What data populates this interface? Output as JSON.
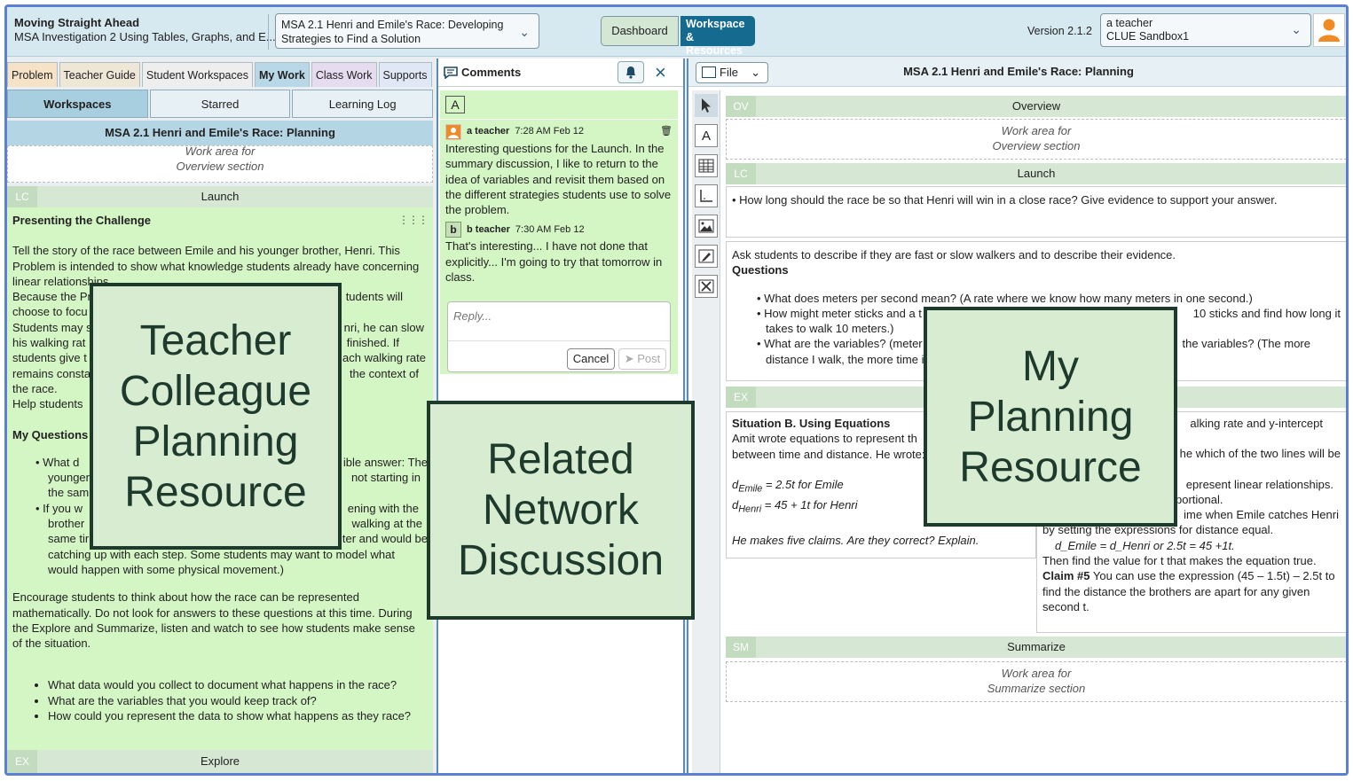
{
  "header": {
    "title": "Moving Straight Ahead",
    "subtitle": "MSA Investigation 2 Using Tables, Graphs, and E...",
    "problem_line1": "MSA 2.1 Henri and Emile's Race: Developing",
    "problem_line2": "Strategies to Find a Solution",
    "dashboard": "Dashboard",
    "workspace_line1": "Workspace",
    "workspace_line2": "& Resources",
    "version": "Version 2.1.2",
    "user_name": "a teacher",
    "user_class": "CLUE Sandbox1"
  },
  "left": {
    "tabs": [
      "Problem",
      "Teacher Guide",
      "Student Workspaces",
      "My Work",
      "Class Work",
      "Supports"
    ],
    "subtabs": [
      "Workspaces",
      "Starred",
      "Learning Log"
    ],
    "doc_title": "MSA 2.1 Henri and Emile's Race: Planning",
    "work_area_l1": "Work area for",
    "work_area_l2": "Overview section",
    "section_lc_code": "LC",
    "section_lc": "Launch",
    "heading": "Presenting the Challenge",
    "p1": "Tell the story of the race between Emile and his younger brother, Henri. This Problem is intended to show what knowledge students already have concerning linear relationships.",
    "p2a": "Because the Pr",
    "p2b": "tudents will",
    "p3a": "choose to focu",
    "p4a": "Students may s",
    "p4b": "nri, he can slow",
    "p5a": "his walking rat",
    "p5b": "finished. If",
    "p6a": "students give t",
    "p6b": "ach walking rate",
    "p7a": "remains consta",
    "p7b": "the context of",
    "p8": "the race.",
    "p9": "Help students",
    "questions_heading": "My Questions",
    "q1a": "What d",
    "q1b": "ible answer: The",
    "q2a": "younger",
    "q2b": "not starting in",
    "q3a": "the sam",
    "q4a": "If you w",
    "q4b": "ening with the",
    "q5a": "brother",
    "q5b": "walking at the",
    "q6a": "same tir",
    "q6b": "ter and would be",
    "q7": "catching up with each step. Some students may want to model what would happen with some physical movement.)",
    "p10": "Encourage students to think about how the race can be represented mathematically. Do not look for answers to these questions at this time. During the Explore and Summarize, listen and watch to see how students make sense of the situation.",
    "bullets": [
      "What data would you collect to document what happens in the race?",
      "What are the variables that you would keep track of?",
      "How could you represent the data to show what happens as they race?"
    ],
    "section_ex_code": "EX",
    "section_ex": "Explore"
  },
  "comments": {
    "title": "Comments",
    "c1_author": "a teacher",
    "c1_time": "7:28 AM Feb 12",
    "c1_text": "Interesting questions for the Launch. In the summary discussion, I like to return to the idea of variables and revisit them based on the different strategies students use to solve the problem.",
    "c2_initial": "b",
    "c2_author": "b teacher",
    "c2_time": "7:30 AM Feb 12",
    "c2_text": "That's interesting... I have not done that explicitly... I'm going to try that tomorrow in class.",
    "reply_placeholder": "Reply...",
    "cancel": "Cancel",
    "post": "Post"
  },
  "right": {
    "file": "File",
    "title": "MSA 2.1 Henri and Emile's Race: Planning",
    "ov_code": "OV",
    "ov": "Overview",
    "work_ov_l1": "Work area for",
    "work_ov_l2": "Overview section",
    "lc_code": "LC",
    "lc": "Launch",
    "lc_bullet": "• How long should the race be so that Henri will win in a close race? Give evidence to support your answer.",
    "ask": "Ask students to describe if they are fast or slow walkers and to describe their evidence.",
    "questions": "Questions",
    "rq1": "What does meters per second mean? (A rate where we know how many meters in one second.)",
    "rq2a": "How might meter sticks and a t",
    "rq2b": "10 sticks and find how long it",
    "rq2c": "takes to walk 10 meters.)",
    "rq3a": "What are the variables? (meter",
    "rq3b": "the variables? (The more",
    "rq3c": "distance I walk, the more time i",
    "ex_code": "EX",
    "sit_title": "Situation B. Using Equations",
    "sit_l1": "Amit wrote equations to represent th",
    "sit_l2": "between time and distance. He wrote:",
    "eq1_pre": "d",
    "eq1_sub": "Emile",
    "eq1_post": " = 2.5t  for Emile",
    "eq2_pre": "d",
    "eq2_sub": "Henri",
    "eq2_post": " = 45 + 1t  for Henri",
    "claims": "He makes five claims. Are they correct? Explain.",
    "r_l1": "alking rate and y-intercept",
    "r_l2": "he which of the two lines will be",
    "r_l3": "epresent linear relationships.",
    "r_l4": "portional.",
    "r_l5": "ime when Emile catches Henri",
    "r_l6": "by setting the expressions for distance equal.",
    "r_eq": "d_Emile  =  d_Henri   or    2.5t  = 45 +1t.",
    "r_l7": "Then find the value for t that makes the equation true.",
    "r_claim": "Claim #5",
    "r_l8": " You can use the expression (45 – 1.5t) – 2.5t to find the distance the brothers are apart for any given second t.",
    "sm_code": "SM",
    "sm": "Summarize",
    "work_sm_l1": "Work area for",
    "work_sm_l2": "Summarize section"
  },
  "overlays": {
    "teacher": [
      "Teacher",
      "Colleague",
      "Planning",
      "Resource"
    ],
    "related": [
      "Related",
      "Network",
      "Discussion"
    ],
    "my": [
      "My",
      "Planning",
      "Resource"
    ]
  }
}
